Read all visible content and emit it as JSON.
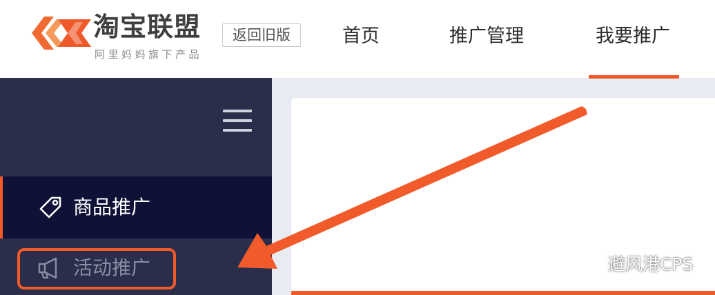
{
  "header": {
    "brand_name": "淘宝联盟",
    "brand_subtitle": "阿里妈妈旗下产品",
    "old_version_label": "返回旧版",
    "nav": [
      {
        "label": "首页"
      },
      {
        "label": "推广管理"
      },
      {
        "label": "我要推广",
        "active": true
      }
    ]
  },
  "sidebar": {
    "items": [
      {
        "label": "商品推广",
        "icon": "tag-icon",
        "active": true
      },
      {
        "label": "活动推广",
        "icon": "megaphone-icon",
        "active": false
      }
    ]
  },
  "watermark": {
    "text": "避风港CPS",
    "icon": "wechat-icon"
  },
  "colors": {
    "accent": "#f25a2c",
    "sidebar_bg": "#2b2e4a",
    "sidebar_active_bg": "#0f1236",
    "content_bg": "#e9ebf2"
  }
}
